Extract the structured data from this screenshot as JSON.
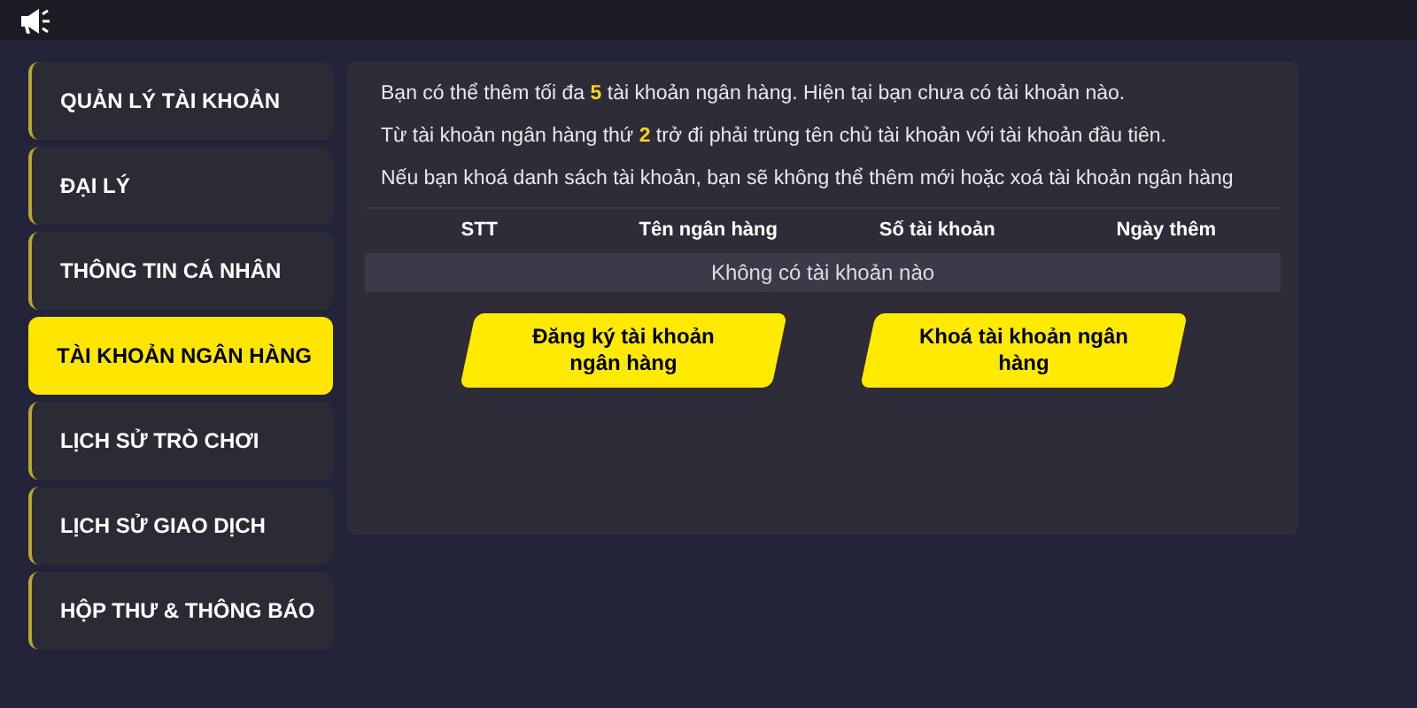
{
  "sidebar": {
    "items": [
      {
        "label": "QUẢN LÝ TÀI KHOẢN",
        "selected": false
      },
      {
        "label": "ĐẠI LÝ",
        "selected": false
      },
      {
        "label": "THÔNG TIN CÁ NHÂN",
        "selected": false
      },
      {
        "label": "TÀI KHOẢN NGÂN HÀNG",
        "selected": true
      },
      {
        "label": "LỊCH SỬ TRÒ CHƠI",
        "selected": false
      },
      {
        "label": "LỊCH SỬ GIAO DỊCH",
        "selected": false
      },
      {
        "label": "HỘP THƯ & THÔNG BÁO",
        "selected": false
      }
    ]
  },
  "notes": [
    "Bạn có thể thêm tối đa **5** tài khoản ngân hàng. Hiện tại bạn chưa có tài khoản nào.",
    "Từ tài khoản ngân hàng thứ **2** trở đi phải trùng tên chủ tài khoản với tài khoản đầu tiên.",
    "Nếu bạn khoá danh sách tài khoản, bạn sẽ không thể thêm mới hoặc xoá tài khoản ngân hàng"
  ],
  "table": {
    "columns": [
      "STT",
      "Tên ngân hàng",
      "Số tài khoản",
      "Ngày thêm"
    ],
    "empty_message": "Không có tài khoản nào"
  },
  "buttons": [
    "Đăng ký tài khoản ngân hàng",
    "Khoá tài khoản ngân hàng"
  ]
}
